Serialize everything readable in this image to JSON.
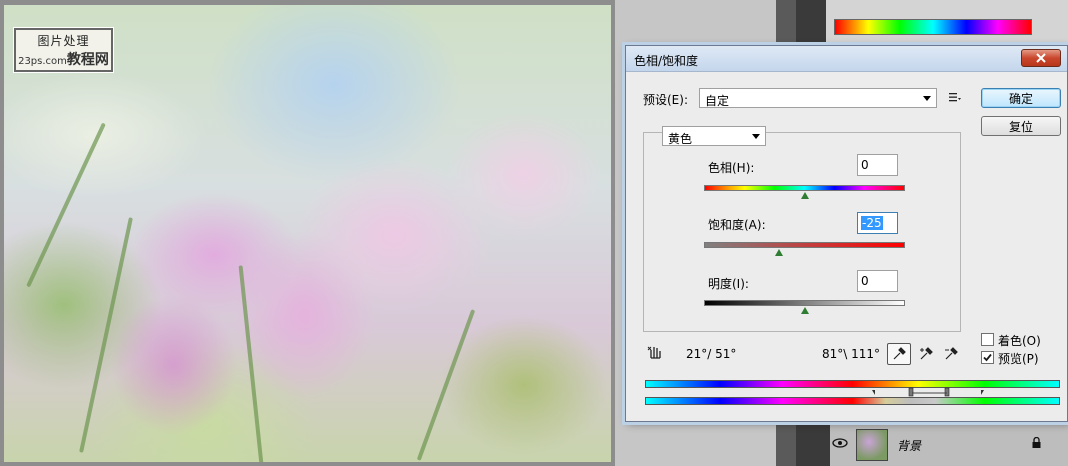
{
  "watermark": {
    "line1": "图片处理",
    "line2_site": "23ps.com",
    "line2_brand": "教程网"
  },
  "dialog": {
    "title": "色相/饱和度",
    "close_label": "✕",
    "preset": {
      "label": "预设(E):",
      "value": "自定"
    },
    "buttons": {
      "ok": "确定",
      "reset": "复位"
    },
    "channel": {
      "value": "黄色"
    },
    "sliders": {
      "hue": {
        "label": "色相(H):",
        "value": "0",
        "position_fraction": 0.5
      },
      "saturation": {
        "label": "饱和度(A):",
        "value": "-25",
        "position_fraction": 0.375
      },
      "lightness": {
        "label": "明度(I):",
        "value": "0",
        "position_fraction": 0.5
      }
    },
    "range": {
      "left": "21°/ 51°",
      "right": "81°\\ 111°"
    },
    "checkboxes": {
      "colorize": {
        "label": "着色(O)",
        "checked": false
      },
      "preview": {
        "label": "预览(P)",
        "checked": true
      }
    }
  },
  "layers": {
    "background_layer_name": "背景"
  },
  "colors": {
    "ok_border": "#3c7fb1",
    "slider_thumb": "#2e7d32",
    "selection": "#3399ff"
  }
}
